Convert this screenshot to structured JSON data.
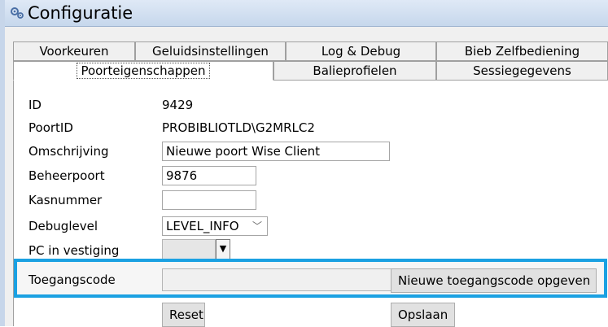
{
  "window": {
    "title": "Configuratie",
    "icon": "gears-icon"
  },
  "tabs_row1": [
    "Voorkeuren",
    "Geluidsinstellingen",
    "Log & Debug",
    "Bieb Zelfbediening"
  ],
  "tabs_row2": [
    "Poorteigenschappen",
    "Balieprofielen",
    "Sessiegegevens"
  ],
  "active_tab": "Poorteigenschappen",
  "fields": {
    "id": {
      "label": "ID",
      "value": "9429"
    },
    "poortid": {
      "label": "PoortID",
      "value": "PROBIBLIOTLD\\G2MRLC2"
    },
    "omschrijving": {
      "label": "Omschrijving",
      "value": "Nieuwe poort Wise Client"
    },
    "beheerpoort": {
      "label": "Beheerpoort",
      "value": "9876"
    },
    "kasnummer": {
      "label": "Kasnummer",
      "value": ""
    },
    "debuglevel": {
      "label": "Debuglevel",
      "value": "LEVEL_INFO"
    },
    "pc_in_vestiging": {
      "label": "PC in vestiging",
      "value": ""
    },
    "toegangscode": {
      "label": "Toegangscode",
      "value": ""
    }
  },
  "buttons": {
    "new_code": "Nieuwe toegangscode opgeven",
    "reset": "Reset",
    "save": "Opslaan"
  },
  "colors": {
    "highlight": "#1ba1e2",
    "titlebar": "#c6d7ec"
  }
}
